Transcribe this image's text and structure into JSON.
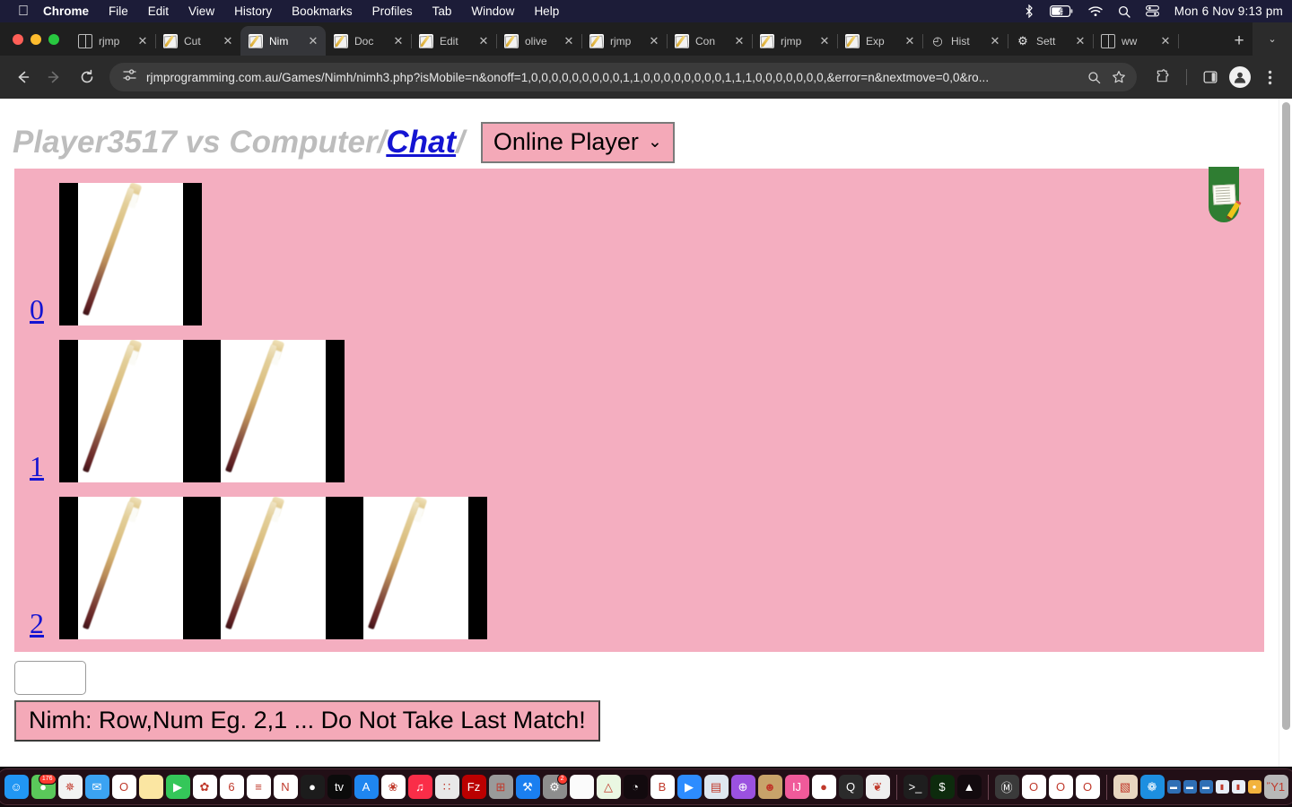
{
  "menubar": {
    "apple_icon": "apple-logo",
    "items": [
      "Chrome",
      "File",
      "Edit",
      "View",
      "History",
      "Bookmarks",
      "Profiles",
      "Tab",
      "Window",
      "Help"
    ],
    "status_icons": [
      "bluetooth-icon",
      "battery-charging-icon",
      "wifi-icon",
      "search-icon",
      "control-center-icon"
    ],
    "clock": "Mon 6 Nov  9:13 pm"
  },
  "browser": {
    "tabs": [
      {
        "label": "rjmp",
        "favicon": "globe-icon",
        "active": false
      },
      {
        "label": "Cut",
        "favicon": "notepad-icon",
        "active": false
      },
      {
        "label": "Nim",
        "favicon": "notepad-icon",
        "active": true
      },
      {
        "label": "Doc",
        "favicon": "notepad-icon",
        "active": false
      },
      {
        "label": "Edit",
        "favicon": "notepad-icon",
        "active": false
      },
      {
        "label": "olive",
        "favicon": "notepad-icon",
        "active": false
      },
      {
        "label": "rjmp",
        "favicon": "notepad-icon",
        "active": false
      },
      {
        "label": "Con",
        "favicon": "notepad-icon",
        "active": false
      },
      {
        "label": "rjmp",
        "favicon": "notepad-icon",
        "active": false
      },
      {
        "label": "Exp",
        "favicon": "notepad-icon",
        "active": false
      },
      {
        "label": "Hist",
        "favicon": "history-icon",
        "active": false
      },
      {
        "label": "Sett",
        "favicon": "gear-icon",
        "active": false
      },
      {
        "label": "ww",
        "favicon": "globe-icon",
        "active": false
      }
    ],
    "close_glyph": "✕",
    "newtab_glyph": "+",
    "tablist_glyph": "⌄",
    "toolbar": {
      "back_glyph": "←",
      "forward_glyph": "→",
      "reload_glyph": "⟳",
      "url": "rjmprogramming.com.au/Games/Nimh/nimh3.php?isMobile=n&onoff=1,0,0,0,0,0,0,0,0,0,1,1,0,0,0,0,0,0,0,0,1,1,1,0,0,0,0,0,0,0,&error=n&nextmove=0,0&ro...",
      "site_info_icon": "site-settings-icon",
      "zoom_icon": "search-icon",
      "bookmark_icon": "star-icon",
      "extensions_icon": "puzzle-icon",
      "sidepanel_icon": "side-panel-icon",
      "profile_icon": "profile-avatar-icon",
      "menu_icon": "three-dot-menu-icon"
    }
  },
  "page": {
    "title_prefix": "Player3517 vs Computer/",
    "title_link": "Chat",
    "title_suffix": "/",
    "player_select": {
      "value": "Online Player",
      "caret": "⌄",
      "options": [
        "Online Player"
      ]
    },
    "notepad_badge": "notepad-pencil-icon",
    "board": {
      "rows": [
        {
          "label": "0",
          "matches": 1
        },
        {
          "label": "1",
          "matches": 2
        },
        {
          "label": "2",
          "matches": 3
        }
      ],
      "background_color": "#f4aec0",
      "match_icon": "matchstick-icon"
    },
    "form": {
      "input_value": "",
      "input_placeholder": "",
      "submit_label": "Nimh: Row,Num Eg. 2,1 ... Do Not Take Last Match!",
      "submit_color": "#f4a9b8"
    }
  },
  "dock": {
    "items": [
      {
        "name": "finder",
        "glyph": "☺",
        "bg": "#2196f3",
        "running": true
      },
      {
        "name": "messages",
        "glyph": "●",
        "bg": "#5ac85a",
        "running": true,
        "badge": "176"
      },
      {
        "name": "safari",
        "glyph": "✵",
        "bg": "#f2f2f2",
        "running": true
      },
      {
        "name": "mail",
        "glyph": "✉",
        "bg": "#3ba3f2",
        "running": true
      },
      {
        "name": "opera",
        "glyph": "O",
        "bg": "#ffffff",
        "running": false
      },
      {
        "name": "notes",
        "glyph": "",
        "bg": "#fbe6a2",
        "running": false
      },
      {
        "name": "facetime",
        "glyph": "▶",
        "bg": "#34c759",
        "running": false
      },
      {
        "name": "photos",
        "glyph": "✿",
        "bg": "#ffffff",
        "running": false
      },
      {
        "name": "calendar",
        "glyph": "6",
        "bg": "#ffffff",
        "running": false
      },
      {
        "name": "reminders",
        "glyph": "≡",
        "bg": "#ffffff",
        "running": false
      },
      {
        "name": "news",
        "glyph": "N",
        "bg": "#ffffff",
        "running": false
      },
      {
        "name": "firefox",
        "glyph": "●",
        "bg": "#1c1c1c",
        "running": false
      },
      {
        "name": "apple-tv",
        "glyph": "tv",
        "bg": "#0b0b0b",
        "running": false
      },
      {
        "name": "app-store",
        "glyph": "A",
        "bg": "#1f86f0",
        "running": false
      },
      {
        "name": "paintbrush",
        "glyph": "❀",
        "bg": "#ffffff",
        "running": true
      },
      {
        "name": "music",
        "glyph": "♫",
        "bg": "#fa2d48",
        "running": false
      },
      {
        "name": "launchpad",
        "glyph": "∷",
        "bg": "#e8e8e8",
        "running": false
      },
      {
        "name": "filezilla",
        "glyph": "Fz",
        "bg": "#bb0000",
        "running": true
      },
      {
        "name": "calculator",
        "glyph": "⊞",
        "bg": "#9a9a9a",
        "running": false
      },
      {
        "name": "xcode",
        "glyph": "⚒",
        "bg": "#1a7ff0",
        "running": false
      },
      {
        "name": "system-settings",
        "glyph": "⚙",
        "bg": "#8d8d8d",
        "running": false,
        "badge": "2"
      },
      {
        "name": "textedit",
        "glyph": "",
        "bg": "#fbfbfb",
        "running": false
      },
      {
        "name": "maps",
        "glyph": "△",
        "bg": "#eaf7e2",
        "running": false
      },
      {
        "name": "gimp",
        "glyph": "◔",
        "bg": "#120a0e",
        "running": false
      },
      {
        "name": "bbedit",
        "glyph": "B",
        "bg": "#ffffff",
        "running": true
      },
      {
        "name": "zoom",
        "glyph": "▶",
        "bg": "#2d8cff",
        "running": false
      },
      {
        "name": "screens",
        "glyph": "▤",
        "bg": "#dfe6ef",
        "running": true
      },
      {
        "name": "podcasts",
        "glyph": "⊕",
        "bg": "#9b51e0",
        "running": false
      },
      {
        "name": "contacts",
        "glyph": "☻",
        "bg": "#c8a36a",
        "running": false
      },
      {
        "name": "intellij",
        "glyph": "IJ",
        "bg": "#f05a9a",
        "running": true
      },
      {
        "name": "chrome",
        "glyph": "●",
        "bg": "#ffffff",
        "running": true
      },
      {
        "name": "quicktime",
        "glyph": "Q",
        "bg": "#2b2b2b",
        "running": true
      },
      {
        "name": "inkscape",
        "glyph": "❦",
        "bg": "#efefef",
        "running": false
      },
      {
        "name": "terminal",
        "glyph": ">_",
        "bg": "#1e1e1e",
        "running": true
      },
      {
        "name": "iterm",
        "glyph": "$",
        "bg": "#0d2b0d",
        "running": false
      },
      {
        "name": "affinity",
        "glyph": "▲",
        "bg": "#120a0e",
        "running": false
      },
      {
        "name": "tor-browser",
        "glyph": "Ⓜ",
        "bg": "#3a3a3a",
        "running": true
      },
      {
        "name": "opera-1",
        "glyph": "O",
        "bg": "#ffffff",
        "running": false
      },
      {
        "name": "opera-2",
        "glyph": "O",
        "bg": "#ffffff",
        "running": true
      },
      {
        "name": "opera-3",
        "glyph": "O",
        "bg": "#ffffff",
        "running": true
      },
      {
        "name": "juice",
        "glyph": "▧",
        "bg": "#e8d6c0",
        "running": false
      },
      {
        "name": "globe-app",
        "glyph": "❁",
        "bg": "#1d8fe0",
        "running": false
      },
      {
        "name": "minimized-1",
        "glyph": "▬",
        "bg": "#2f6fb5",
        "running": false,
        "small": true
      },
      {
        "name": "minimized-2",
        "glyph": "▬",
        "bg": "#2f6fb5",
        "running": false,
        "small": true
      },
      {
        "name": "minimized-3",
        "glyph": "▬",
        "bg": "#2f6fb5",
        "running": false,
        "small": true
      },
      {
        "name": "minimized-4",
        "glyph": "▮",
        "bg": "#e8eef7",
        "running": false,
        "small": true
      },
      {
        "name": "minimized-5",
        "glyph": "▮",
        "bg": "#e8eef7",
        "running": false,
        "small": true
      },
      {
        "name": "minimized-6",
        "glyph": "●",
        "bg": "#f2b33d",
        "running": false,
        "small": true
      },
      {
        "name": "trash",
        "glyph": "Ὕ1",
        "bg": "#b8b8b8",
        "running": false
      }
    ]
  }
}
